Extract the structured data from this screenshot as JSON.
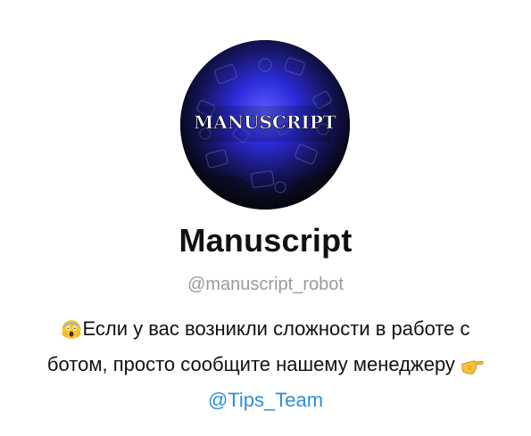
{
  "profile": {
    "avatar_text": "MANUSCRIPT",
    "name": "Manuscript",
    "username": "@manuscript_robot",
    "description": {
      "line1_emoji": "face-screaming-in-fear-icon",
      "line1_text": "Если у вас возникли сложности в работе с",
      "line2_text": "ботом, просто сообщите нашему менеджеру",
      "line2_emoji": "backhand-index-pointing-right-icon",
      "mention": "@Tips_Team"
    }
  },
  "colors": {
    "mention": "#2f8ed6",
    "username": "#9a9a9a",
    "avatar_glow": "#2b2bd8"
  }
}
